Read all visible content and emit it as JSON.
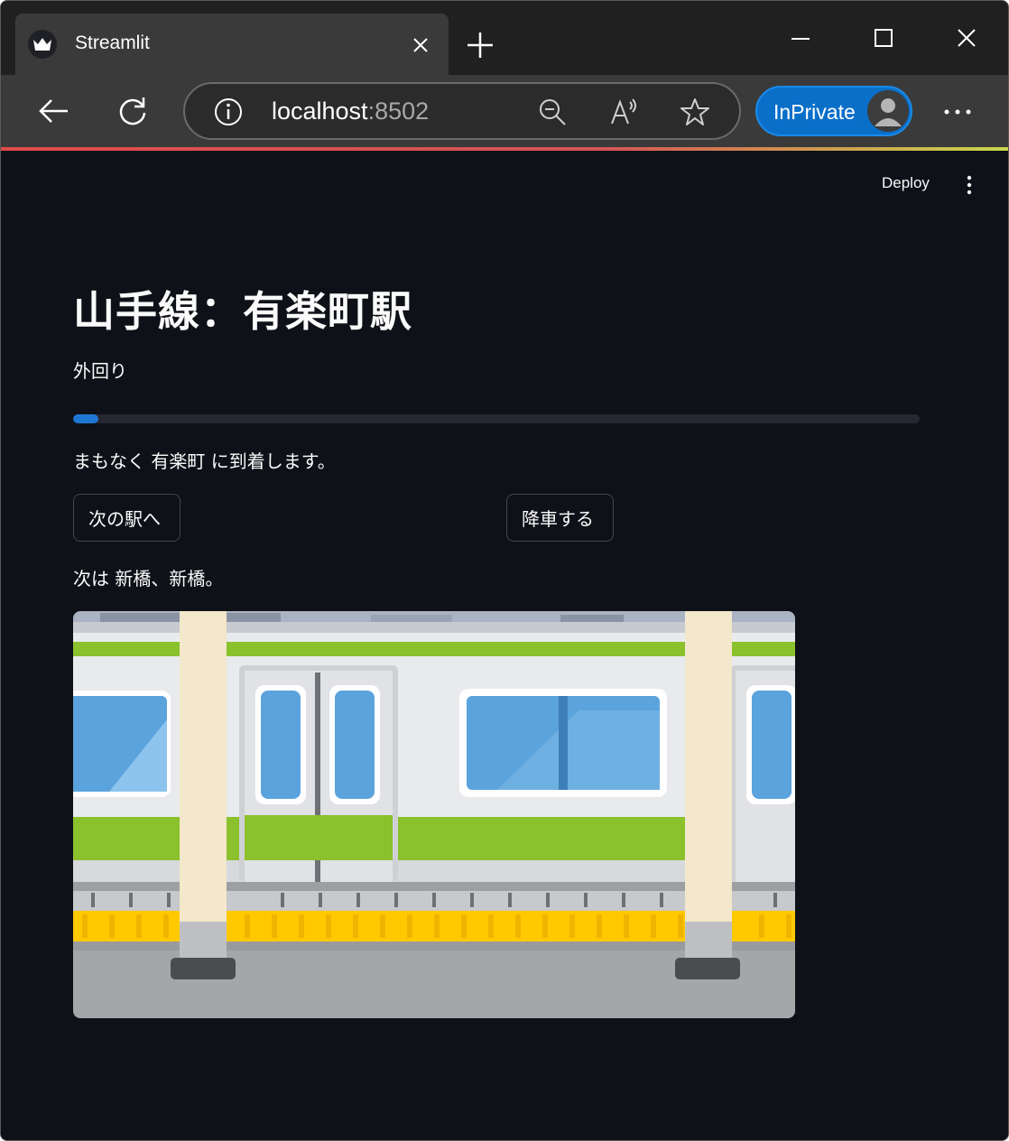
{
  "browser": {
    "tab_title": "Streamlit",
    "url_host": "localhost",
    "url_port": ":8502",
    "inprivate_label": "InPrivate"
  },
  "app": {
    "deploy_label": "Deploy",
    "title": "山手線：有楽町駅",
    "direction": "外回り",
    "progress_fraction": 0.03,
    "status_message": "まもなく 有楽町 に到着します。",
    "next_button_label": "次の駅へ",
    "exit_button_label": "降車する",
    "next_station_message": "次は 新橋、新橋。"
  },
  "colors": {
    "app_background": "#0e1117",
    "progress_fill": "#1f77d4",
    "progress_track": "#262730",
    "train_stripe": "#8ac12c",
    "platform_line": "#ffc900",
    "inprivate_blue": "#0a6fc9"
  },
  "icons": {
    "tab_favicon": "streamlit-crown-icon",
    "close_tab": "close-icon",
    "new_tab": "plus-icon",
    "back": "arrow-left-icon",
    "refresh": "refresh-icon",
    "site_info": "info-icon",
    "zoom": "zoom-out-icon",
    "read_aloud": "read-aloud-icon",
    "favorite": "star-icon",
    "more": "more-horizontal-icon",
    "app_menu": "more-vertical-icon"
  }
}
